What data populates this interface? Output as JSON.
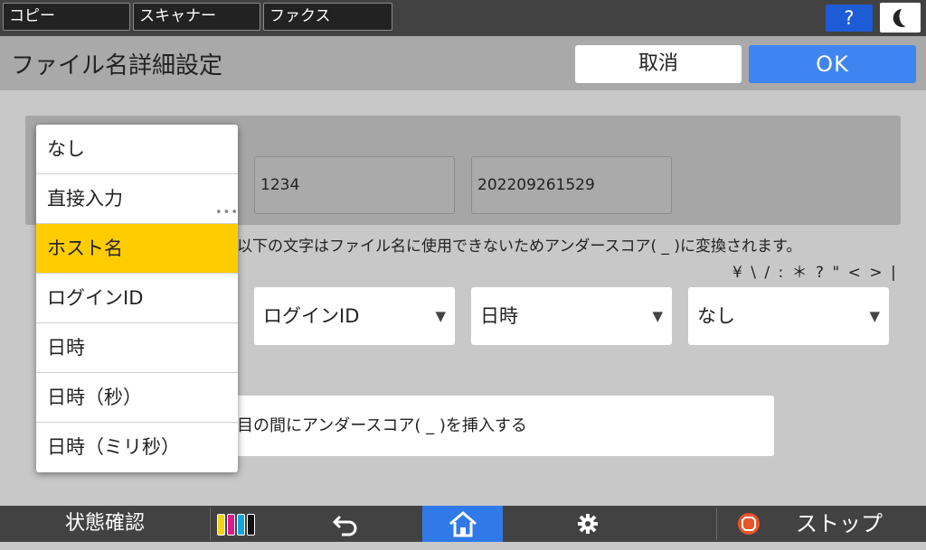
{
  "app_tabs": [
    "コピー",
    "スキャナー",
    "ファクス"
  ],
  "help_label": "?",
  "page_title": "ファイル名詳細設定",
  "buttons": {
    "cancel": "取消",
    "ok": "OK"
  },
  "preview_fields": [
    "1234",
    "202209261529"
  ],
  "note": "以下の文字はファイル名に使用できないためアンダースコア( _ )に変換されます。",
  "forbidden_chars": "¥ \\ / : ＊ ? \" < > |",
  "selects": [
    {
      "value": "ログインID"
    },
    {
      "value": "日時"
    },
    {
      "value": "なし"
    }
  ],
  "underscore_option": "目の間にアンダースコア( _ )を挿入する",
  "dropdown": {
    "items": [
      "なし",
      "直接入力",
      "ホスト名",
      "ログインID",
      "日時",
      "日時（秒）",
      "日時（ミリ秒）"
    ],
    "selected_index": 2,
    "ellipsis": "•••"
  },
  "bottom_bar": {
    "status": "状態確認",
    "stop": "ストップ"
  },
  "colors": {
    "accent": "#3f85f2",
    "selected": "#ffcc00",
    "home": "#2f7ae8",
    "stop": "#e8542a"
  },
  "icons": [
    "help-icon",
    "night-mode-icon",
    "dropdown-arrow-icon",
    "toner-icon",
    "back-icon",
    "home-icon",
    "gear-icon",
    "stop-icon"
  ]
}
